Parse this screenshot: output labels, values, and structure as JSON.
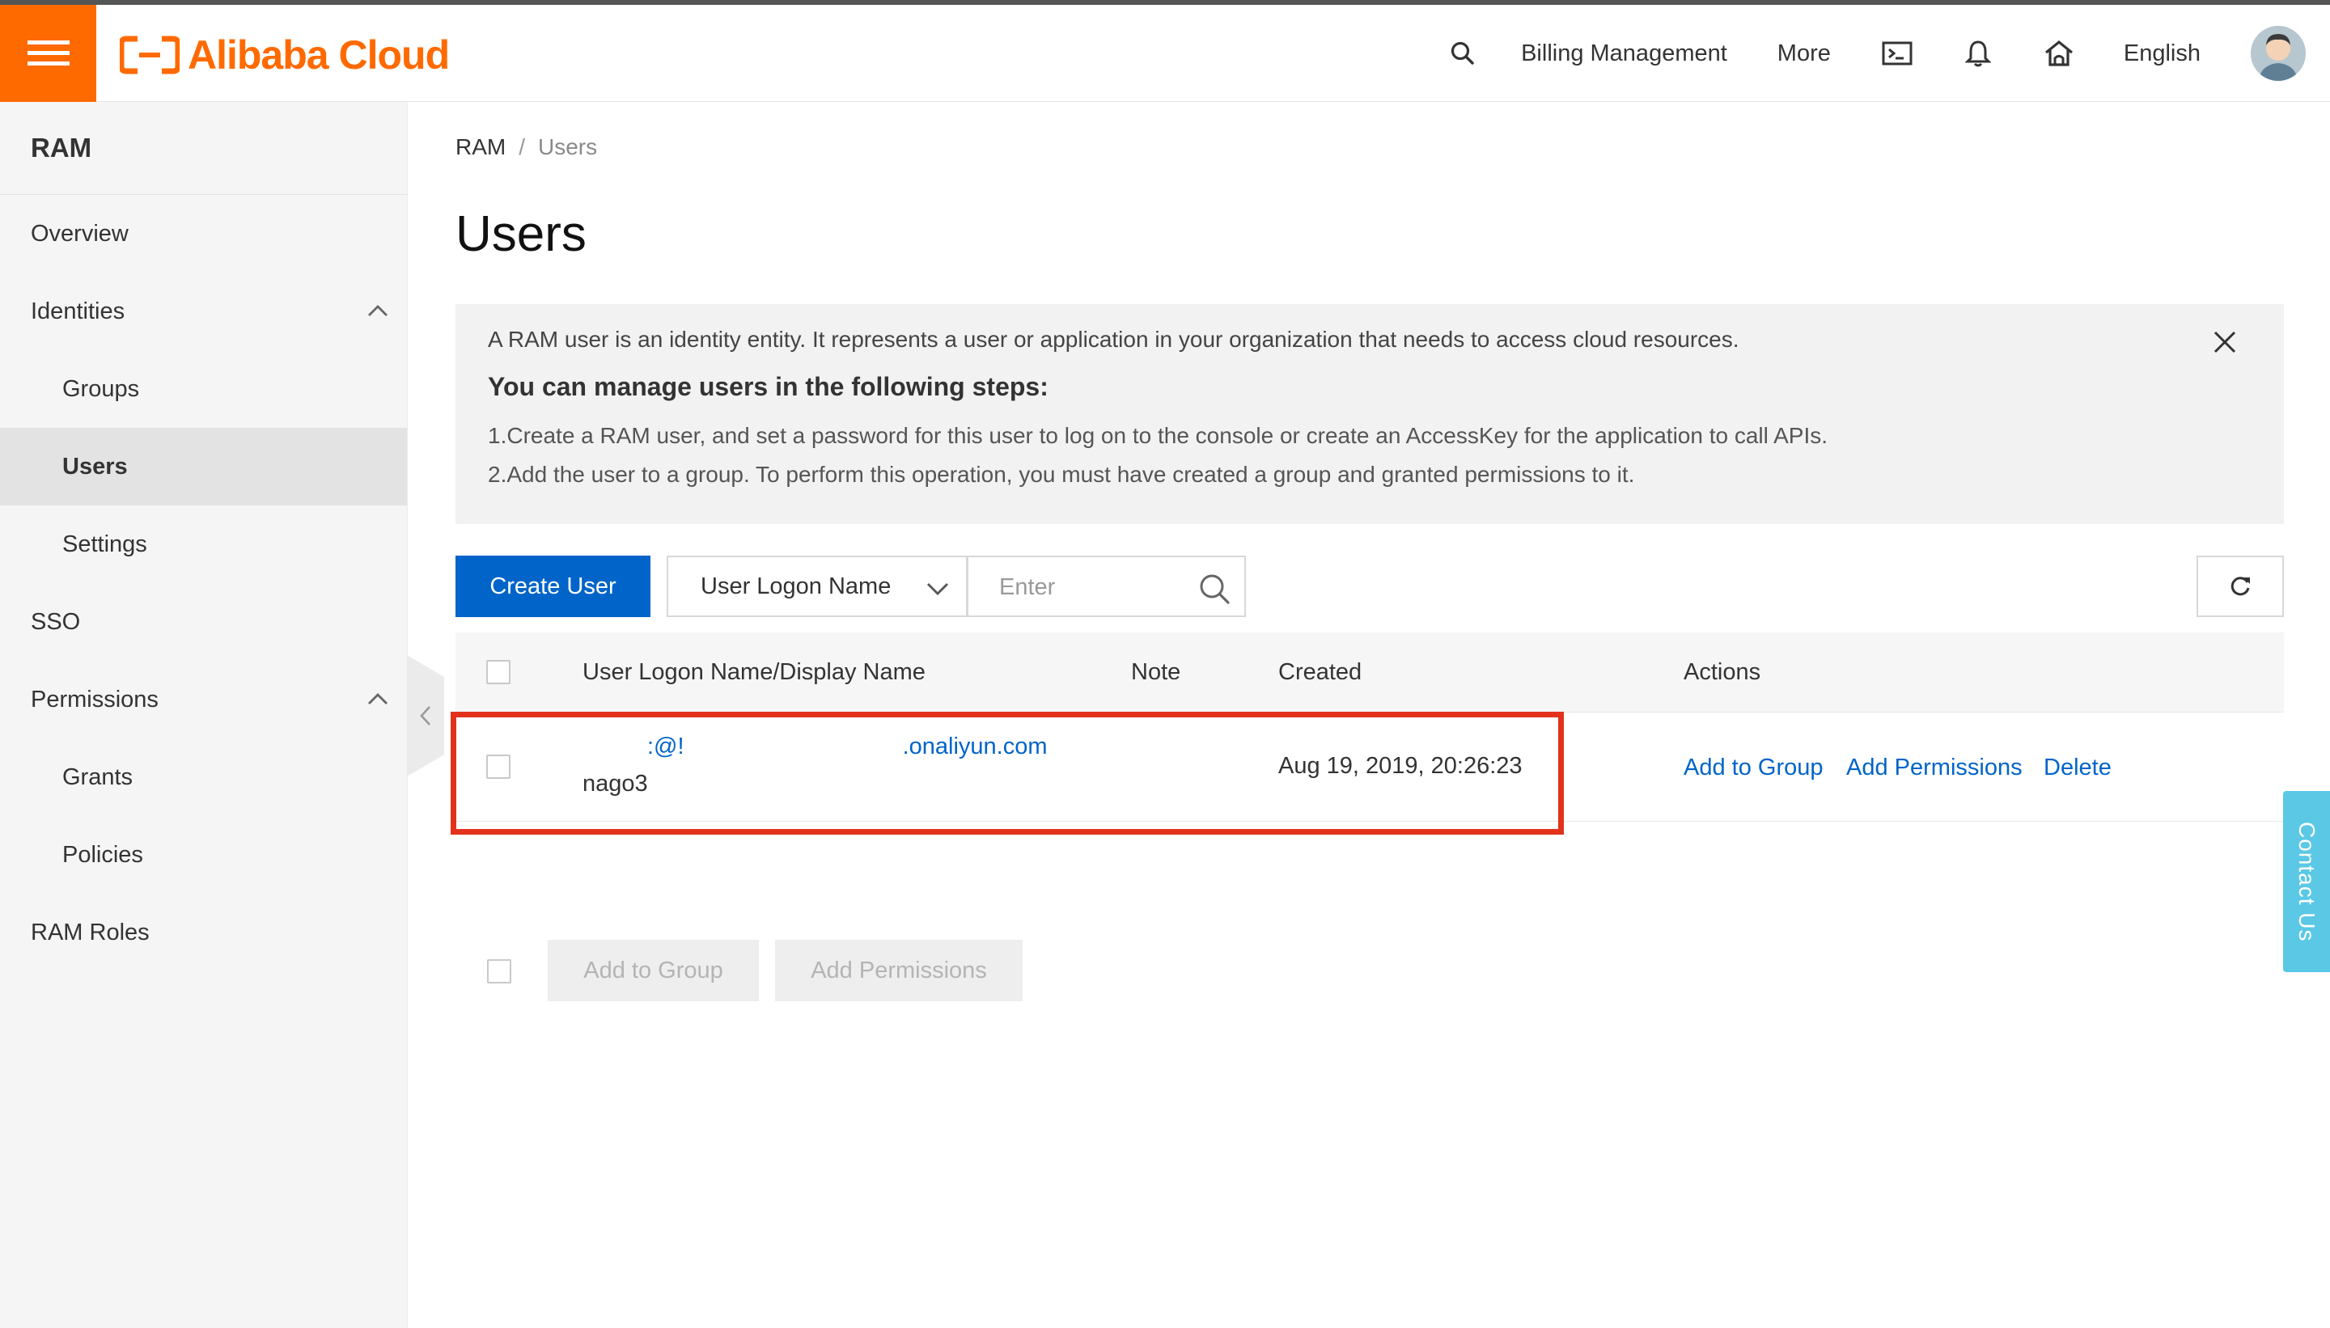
{
  "topbar": {
    "logo_text": "Alibaba Cloud",
    "nav": [
      "Billing Management",
      "More"
    ],
    "language": "English",
    "icons": [
      "menu-icon",
      "search-icon",
      "terminal-icon",
      "bell-icon",
      "home-icon"
    ]
  },
  "sidebar": {
    "title": "RAM",
    "items": [
      {
        "label": "Overview"
      },
      {
        "label": "Identities"
      },
      {
        "label": "Groups"
      },
      {
        "label": "Users"
      },
      {
        "label": "Settings"
      },
      {
        "label": "SSO"
      },
      {
        "label": "Permissions"
      },
      {
        "label": "Grants"
      },
      {
        "label": "Policies"
      },
      {
        "label": "RAM Roles"
      }
    ]
  },
  "breadcrumb": {
    "root": "RAM",
    "sep": "/",
    "current": "Users"
  },
  "page": {
    "title": "Users"
  },
  "info": {
    "desc": "A RAM user is an identity entity. It represents a user or application in your organization that needs to access cloud resources.",
    "heading": "You can manage users in the following steps:",
    "step1": "1.Create a RAM user, and set a password for this user to log on to the console or create an AccessKey for the application to call APIs.",
    "step2": "2.Add the user to a group. To perform this operation, you must have created a group and granted permissions to it."
  },
  "toolbar": {
    "create_label": "Create User",
    "filter_selected": "User Logon Name",
    "search_placeholder": "Enter"
  },
  "table": {
    "headers": [
      "User Logon Name/Display Name",
      "Note",
      "Created",
      "Actions"
    ],
    "rows": [
      {
        "logon_prefix": ":@!",
        "logon_suffix": ".onaliyun.com",
        "display_name": "nago3",
        "created": "Aug 19, 2019, 20:26:23",
        "actions": [
          "Add to Group",
          "Add Permissions",
          "Delete"
        ]
      }
    ]
  },
  "batch": {
    "add_group": "Add to Group",
    "add_permissions": "Add Permissions"
  },
  "contact": {
    "label": "Contact Us"
  },
  "colors": {
    "brand": "#ff6a00",
    "primary": "#0064c8",
    "highlight": "#e2321c",
    "contact": "#5bc8e6"
  }
}
